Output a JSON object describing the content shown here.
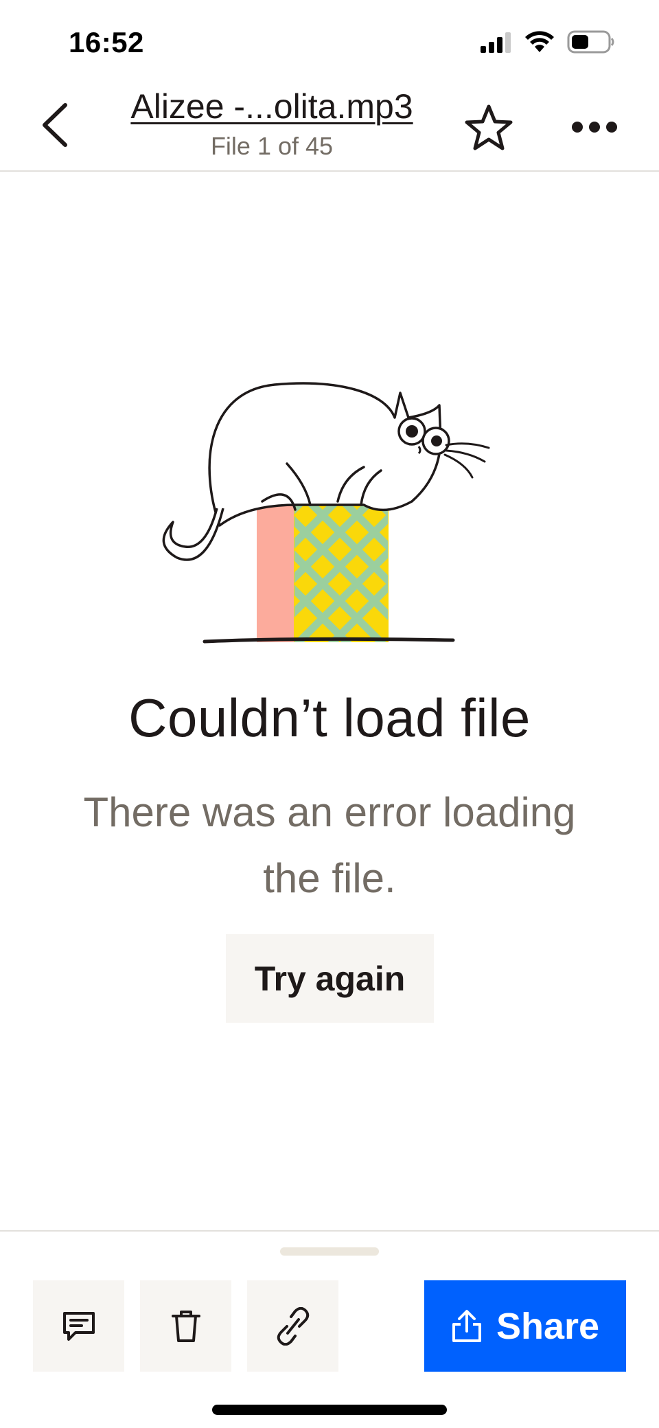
{
  "status_bar": {
    "time": "16:52"
  },
  "header": {
    "title": "Alizee -...olita.mp3",
    "subtitle": "File 1 of 45"
  },
  "error": {
    "title": "Couldn’t load file",
    "message": "There was an error loading the file.",
    "retry_label": "Try again"
  },
  "toolbar": {
    "share_label": "Share",
    "buttons": [
      "comment-icon",
      "trash-icon",
      "link-icon"
    ]
  },
  "colors": {
    "accent": "#0061fe",
    "button_bg": "#f7f5f2",
    "text_secondary": "#736c64",
    "box_pink": "#fcab9c",
    "box_yellow": "#fad80a",
    "box_green": "#9bcf9e"
  }
}
